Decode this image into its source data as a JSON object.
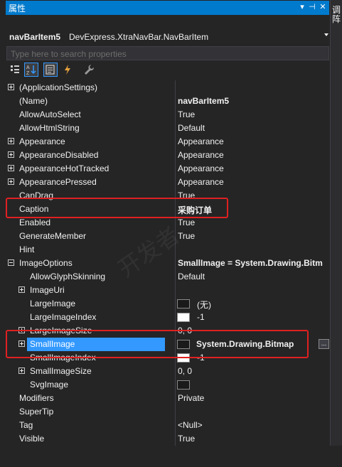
{
  "window": {
    "title": "属性",
    "side_text": "调\n阵"
  },
  "object_selector": {
    "name": "navBarItem5",
    "type": "DevExpress.XtraNavBar.NavBarItem"
  },
  "search": {
    "placeholder": "Type here to search properties"
  },
  "toolbar": [
    "categorized-icon",
    "alphabetical-icon",
    "properties-icon",
    "events-icon",
    "wrench-icon"
  ],
  "properties": [
    {
      "name": "(ApplicationSettings)",
      "value": "",
      "expander": "plus",
      "indent": 0
    },
    {
      "name": "(Name)",
      "value": "navBarItem5",
      "bold": true,
      "indent": 0
    },
    {
      "name": "AllowAutoSelect",
      "value": "True",
      "indent": 0
    },
    {
      "name": "AllowHtmlString",
      "value": "Default",
      "indent": 0
    },
    {
      "name": "Appearance",
      "value": "Appearance",
      "expander": "plus",
      "indent": 0
    },
    {
      "name": "AppearanceDisabled",
      "value": "Appearance",
      "expander": "plus",
      "indent": 0
    },
    {
      "name": "AppearanceHotTracked",
      "value": "Appearance",
      "expander": "plus",
      "indent": 0
    },
    {
      "name": "AppearancePressed",
      "value": "Appearance",
      "expander": "plus",
      "indent": 0
    },
    {
      "name": "CanDrag",
      "value": "True",
      "indent": 0
    },
    {
      "name": "Caption",
      "value": "采购订单",
      "bold": true,
      "indent": 0
    },
    {
      "name": "Enabled",
      "value": "True",
      "indent": 0
    },
    {
      "name": "GenerateMember",
      "value": "True",
      "indent": 0
    },
    {
      "name": "Hint",
      "value": "",
      "indent": 0
    },
    {
      "name": "ImageOptions",
      "value": "SmallImage = System.Drawing.Bitm",
      "bold": true,
      "expander": "minus",
      "indent": 0
    },
    {
      "name": "AllowGlyphSkinning",
      "value": "Default",
      "indent": 1
    },
    {
      "name": "ImageUri",
      "value": "",
      "expander": "plus",
      "indent": 1
    },
    {
      "name": "LargeImage",
      "value": "(无)",
      "swatch": "black",
      "indent": 1
    },
    {
      "name": "LargeImageIndex",
      "value": "-1",
      "swatch": "white",
      "indent": 1
    },
    {
      "name": "LargeImageSize",
      "value": "0, 0",
      "expander": "plus",
      "indent": 1
    },
    {
      "name": "SmallImage",
      "value": "System.Drawing.Bitmap",
      "bold": true,
      "swatch": "bitmap",
      "expander": "plus",
      "selected": true,
      "ellipsis": "...",
      "indent": 1
    },
    {
      "name": "SmallImageIndex",
      "value": "-1",
      "swatch": "white",
      "indent": 1
    },
    {
      "name": "SmallImageSize",
      "value": "0, 0",
      "expander": "plus",
      "indent": 1
    },
    {
      "name": "SvgImage",
      "value": "",
      "swatch": "black",
      "indent": 1
    },
    {
      "name": "Modifiers",
      "value": "Private",
      "indent": 0
    },
    {
      "name": "SuperTip",
      "value": "",
      "indent": 0
    },
    {
      "name": "Tag",
      "value": "<Null>",
      "indent": 0
    },
    {
      "name": "Visible",
      "value": "True",
      "indent": 0
    }
  ],
  "colors": {
    "background": "#252526",
    "selection": "#3399ff",
    "highlight_box": "#e02020",
    "title_bar": "#007acc"
  }
}
